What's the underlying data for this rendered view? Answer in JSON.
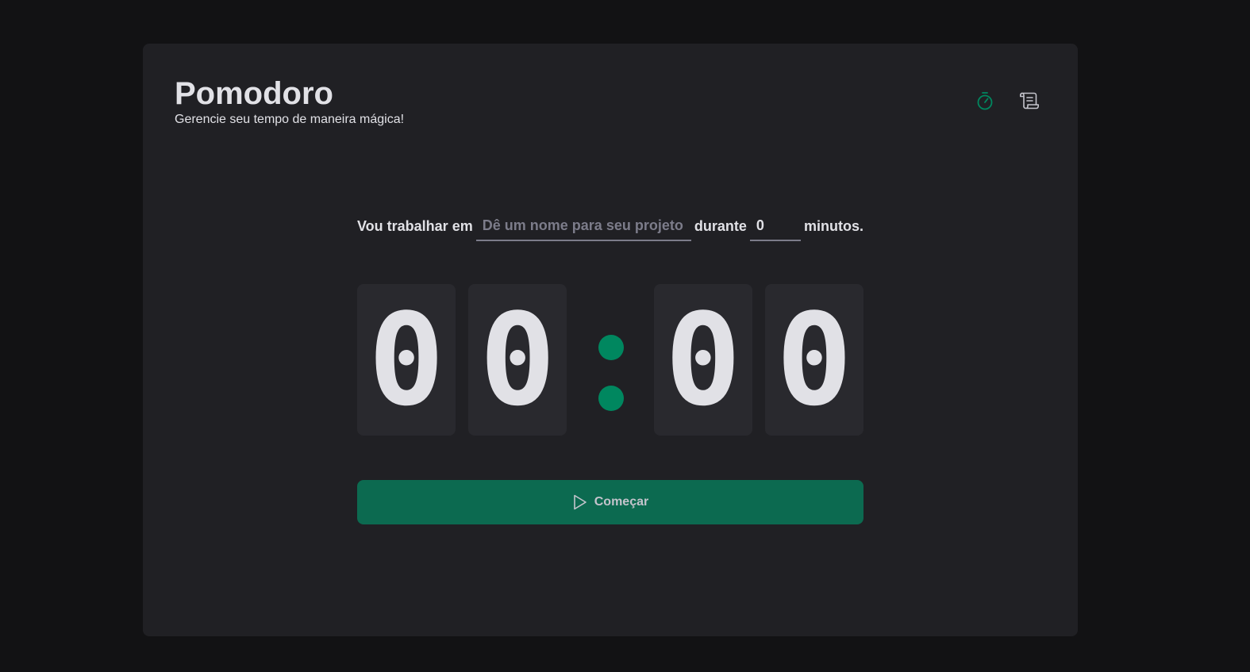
{
  "header": {
    "title": "Pomodoro",
    "subtitle": "Gerencie seu tempo de maneira mágica!",
    "nav": [
      {
        "icon": "timer-icon",
        "active": true
      },
      {
        "icon": "scroll-icon",
        "active": false
      }
    ]
  },
  "form": {
    "task_label": "Vou trabalhar em",
    "task_placeholder": "Dê um nome para seu projeto",
    "task_value": "",
    "duration_label": "durante",
    "minutes_value": "0",
    "minutes_suffix": "minutos."
  },
  "countdown": {
    "minutes_tens": "0",
    "minutes_ones": "0",
    "seconds_tens": "0",
    "seconds_ones": "0"
  },
  "start_button": {
    "label": "Começar",
    "icon": "play-icon"
  },
  "colors": {
    "background": "#121214",
    "panel": "#202024",
    "digit_box": "#29292e",
    "accent": "#00875f",
    "button": "#0c6a50",
    "text": "#e1e1e6",
    "muted": "#7c7c8a"
  }
}
